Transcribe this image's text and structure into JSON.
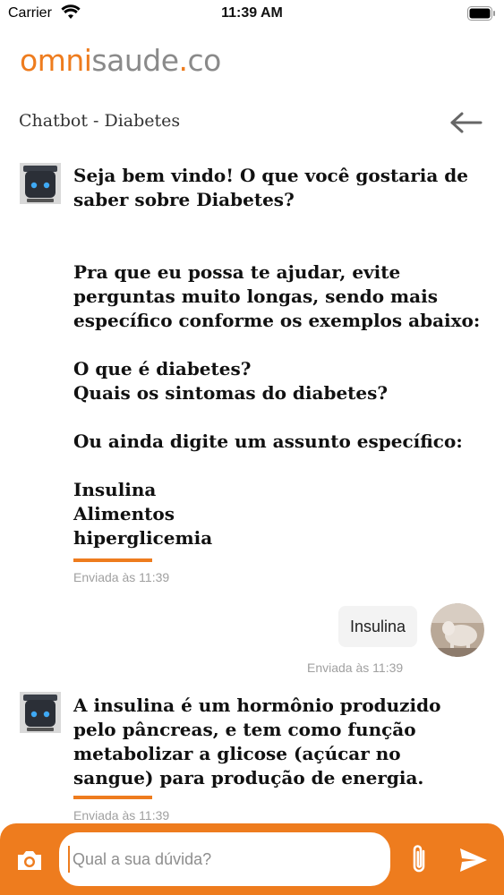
{
  "status_bar": {
    "carrier": "Carrier",
    "time": "11:39 AM"
  },
  "logo": {
    "omni": "omni",
    "saude": "saude",
    "dot": ".",
    "co": "co"
  },
  "header": {
    "title": "Chatbot - Diabetes"
  },
  "messages": [
    {
      "sender": "bot",
      "text": "Seja bem vindo! O que você gostaria de saber sobre Diabetes?",
      "timestamp": ""
    },
    {
      "sender": "bot",
      "text": "Pra que eu possa te ajudar, evite perguntas muito longas, sendo mais específico conforme os exemplos abaixo:\n\nO que é diabetes?\nQuais os sintomas do diabetes?\n\nOu ainda digite um assunto específico:\n\nInsulina\nAlimentos\nhiperglicemia",
      "timestamp": "Enviada às 11:39"
    },
    {
      "sender": "user",
      "text": "Insulina",
      "timestamp": "Enviada às 11:39"
    },
    {
      "sender": "bot",
      "text": "A insulina é um hormônio produzido pelo pâncreas, e tem como função metabolizar a glicose (açúcar no sangue) para produção de energia.",
      "timestamp": "Enviada às 11:39"
    }
  ],
  "input": {
    "placeholder": "Qual a sua dúvida?",
    "value": ""
  },
  "colors": {
    "accent": "#ee7c1e",
    "logo_gray": "#8a8a8a",
    "timestamp": "#a0a0a0",
    "bubble": "#f3f3f3"
  },
  "icons": [
    "wifi-icon",
    "battery-icon",
    "back-arrow-icon",
    "bot-avatar",
    "user-avatar",
    "camera-icon",
    "paperclip-icon",
    "send-icon"
  ]
}
